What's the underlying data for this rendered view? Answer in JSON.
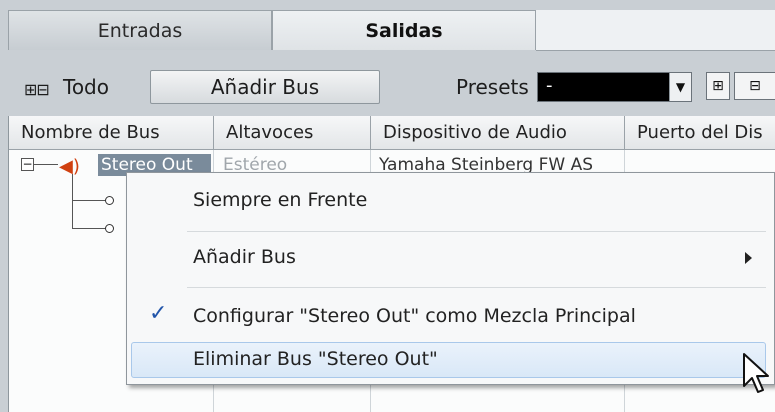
{
  "tabs": {
    "entradas": "Entradas",
    "salidas": "Salidas"
  },
  "toolbar": {
    "expand_icons": "⊞⊟",
    "todo_label": "Todo",
    "add_bus_label": "Añadir Bus",
    "presets_label": "Presets",
    "presets_value": "-"
  },
  "table": {
    "headers": [
      "Nombre de Bus",
      "Altavoces",
      "Dispositivo de Audio",
      "Puerto del Dis"
    ],
    "row": {
      "name": "Stereo Out",
      "speakers": "Estéreo",
      "device": "Yamaha Steinberg FW AS"
    }
  },
  "menu": {
    "items": [
      {
        "label": "Siempre en Frente"
      },
      {
        "label": "Añadir Bus"
      },
      {
        "label": "Configurar \"Stereo Out\" como Mezcla Principal"
      },
      {
        "label": "Eliminar Bus \"Stereo Out\""
      }
    ],
    "check_mark": "✓"
  },
  "colors": {
    "background": "#c9cfd4",
    "selection": "#7a8b9b",
    "menu_hover": "#d9e8f7",
    "speaker": "#d04010"
  },
  "icons": {
    "expand_all": "plus-box-icon",
    "collapse_all": "minus-box-icon",
    "speaker": "speaker-icon",
    "submenu": "triangle-right-icon",
    "cursor": "arrow-cursor-icon"
  }
}
